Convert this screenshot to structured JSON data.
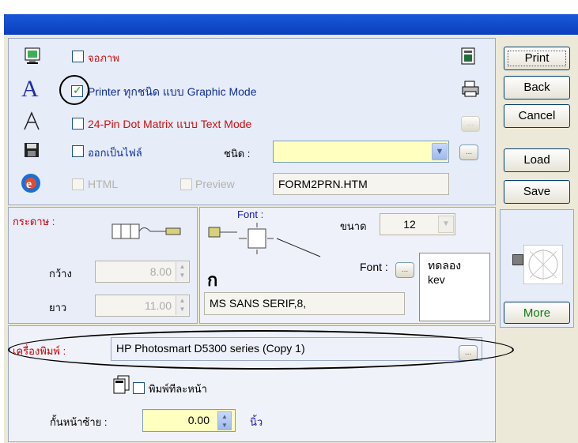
{
  "output": {
    "screen_label": "จอภาพ",
    "printer_graphic_label": "Printer ทุกชนิด แบบ Graphic Mode",
    "dotmatrix_label": "24-Pin Dot Matrix แบบ Text Mode",
    "file_label": "ออกเป็นไฟล์",
    "type_label": "ชนิด :",
    "type_value": "",
    "html_label": "HTML",
    "preview_label": "Preview",
    "filename": "FORM2PRN.HTM",
    "printer_graphic_checked": true
  },
  "buttons": {
    "print": "Print",
    "back": "Back",
    "cancel": "Cancel",
    "load": "Load",
    "save": "Save",
    "more": "More",
    "ellipsis": "..."
  },
  "paper": {
    "label": "กระดาษ :",
    "width_label": "กว้าง",
    "width_value": "8.00",
    "height_label": "ยาว",
    "height_value": "11.00"
  },
  "font": {
    "font_heading": "Font :",
    "size_label": "ขนาด",
    "size_value": "12",
    "font_button_label": "Font :",
    "preview_text": "ทดลอง\nkev",
    "font_name": "MS SANS SERIF,8,",
    "font_icon": "ก"
  },
  "printer": {
    "label": "เครื่องพิมพ์ :",
    "name": "HP Photosmart D5300 series (Copy 1)",
    "print_immediately_label": "พิมพ์ทีละหน้า",
    "margin_label": "กั้นหน้าซ้าย :",
    "margin_value": "0.00",
    "margin_unit": "นิ้ว"
  }
}
